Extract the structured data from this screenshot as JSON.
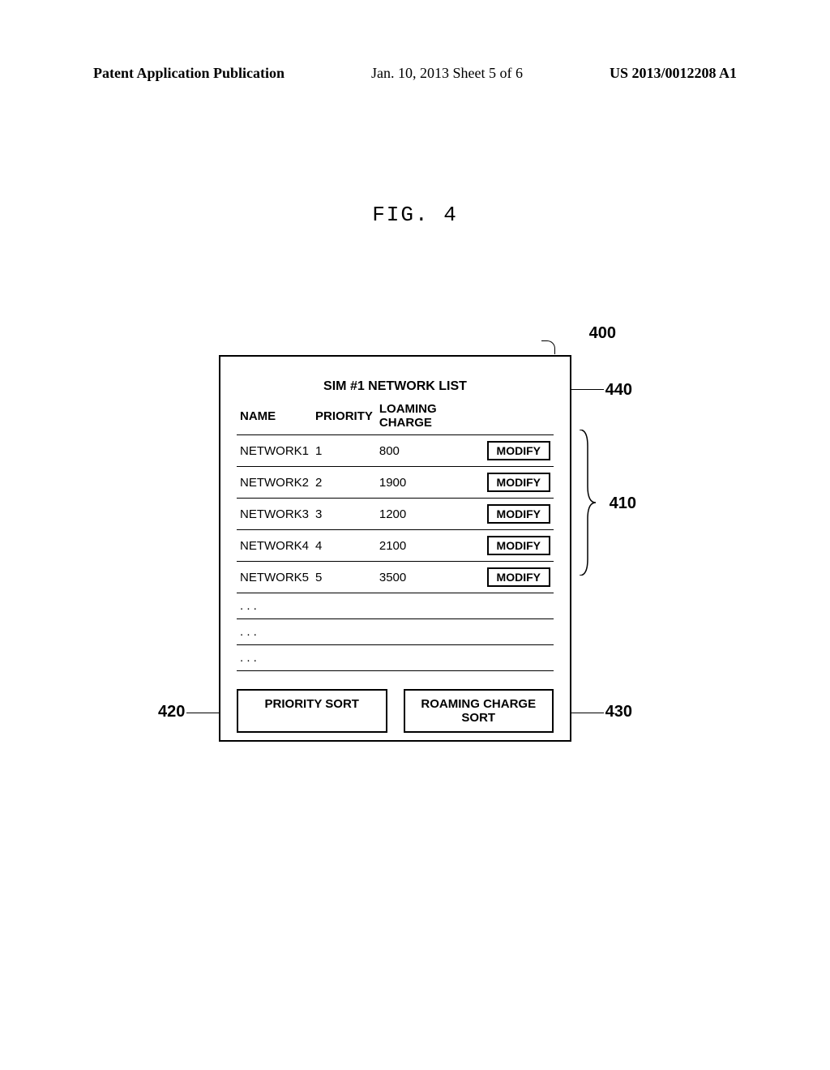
{
  "header": {
    "left": "Patent Application Publication",
    "mid": "Jan. 10, 2013  Sheet 5 of 6",
    "right": "US 2013/0012208 A1"
  },
  "figure_label": "FIG. 4",
  "panel": {
    "title": "SIM #1 NETWORK LIST",
    "columns": {
      "name": "NAME",
      "priority": "PRIORITY",
      "charge": "LOAMING CHARGE"
    },
    "modify_label": "MODIFY",
    "rows": [
      {
        "name": "NETWORK1",
        "priority": "1",
        "charge": "800"
      },
      {
        "name": "NETWORK2",
        "priority": "2",
        "charge": "1900"
      },
      {
        "name": "NETWORK3",
        "priority": "3",
        "charge": "1200"
      },
      {
        "name": "NETWORK4",
        "priority": "4",
        "charge": "2100"
      },
      {
        "name": "NETWORK5",
        "priority": "5",
        "charge": "3500"
      },
      {
        "name": ". . .",
        "priority": "",
        "charge": ""
      },
      {
        "name": ". . .",
        "priority": "",
        "charge": ""
      },
      {
        "name": ". . .",
        "priority": "",
        "charge": ""
      }
    ],
    "sort_priority": "PRIORITY SORT",
    "sort_charge": "ROAMING CHARGE SORT"
  },
  "refs": {
    "r400": "400",
    "r410": "410",
    "r420": "420",
    "r430": "430",
    "r440": "440"
  }
}
